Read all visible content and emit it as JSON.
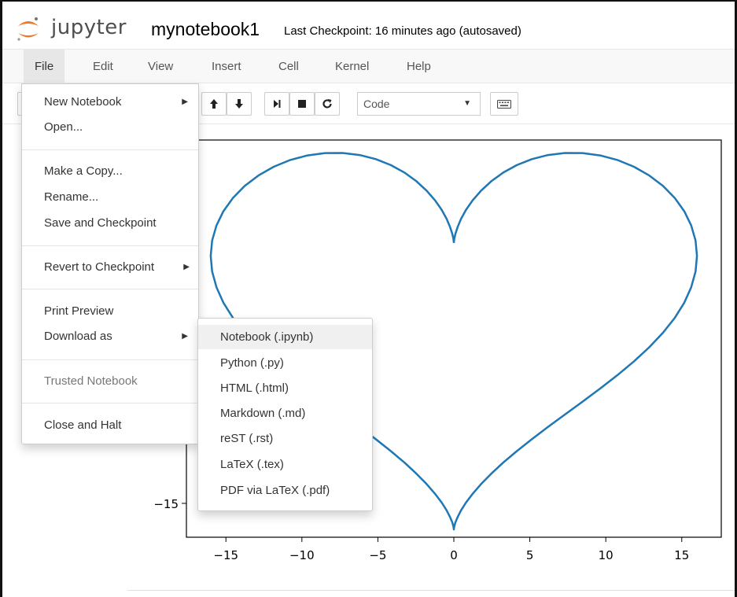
{
  "header": {
    "brand": "jupyter",
    "notebook_name": "mynotebook1",
    "checkpoint_status": "Last Checkpoint: 16 minutes ago (autosaved)"
  },
  "menubar": {
    "items": [
      {
        "label": "File"
      },
      {
        "label": "Edit"
      },
      {
        "label": "View"
      },
      {
        "label": "Insert"
      },
      {
        "label": "Cell"
      },
      {
        "label": "Kernel"
      },
      {
        "label": "Help"
      }
    ]
  },
  "toolbar": {
    "cell_type": "Code",
    "buttons": [
      "arrow-up-icon",
      "arrow-down-icon",
      "step-forward-icon",
      "stop-icon",
      "restart-icon",
      "keyboard-icon"
    ]
  },
  "file_menu": {
    "items": [
      {
        "label": "New Notebook",
        "submenu": true
      },
      {
        "label": "Open..."
      },
      {
        "label": "Make a Copy..."
      },
      {
        "label": "Rename..."
      },
      {
        "label": "Save and Checkpoint"
      },
      {
        "label": "Revert to Checkpoint",
        "submenu": true
      },
      {
        "label": "Print Preview"
      },
      {
        "label": "Download as",
        "submenu": true
      },
      {
        "label": "Trusted Notebook",
        "disabled": true
      },
      {
        "label": "Close and Halt"
      }
    ],
    "submenu_arrow": "▶"
  },
  "download_submenu": {
    "items": [
      {
        "label": "Notebook (.ipynb)",
        "highlighted": true
      },
      {
        "label": "Python (.py)"
      },
      {
        "label": "HTML (.html)"
      },
      {
        "label": "Markdown (.md)"
      },
      {
        "label": "reST (.rst)"
      },
      {
        "label": "LaTeX (.tex)"
      },
      {
        "label": "PDF via LaTeX (.pdf)"
      }
    ]
  },
  "chart_data": {
    "type": "line",
    "title": "",
    "xlabel": "",
    "ylabel": "",
    "xlim": [
      -17.6,
      17.6
    ],
    "ylim": [
      -17.6,
      12.9
    ],
    "x_ticks": [
      -15,
      -10,
      -5,
      0,
      5,
      10,
      15
    ],
    "x_tick_labels": [
      "−15",
      "−10",
      "−5",
      "0",
      "5",
      "10",
      "15"
    ],
    "y_ticks": [
      -15
    ],
    "y_tick_labels": [
      "−15"
    ],
    "series": [
      {
        "color": "#1f77b4",
        "function": "x = 16 sin^3(t), y = 13 cos(t) - 5 cos(2t) - 2 cos(3t) - cos(4t), t in [0, 2π]"
      }
    ],
    "grid": false
  }
}
